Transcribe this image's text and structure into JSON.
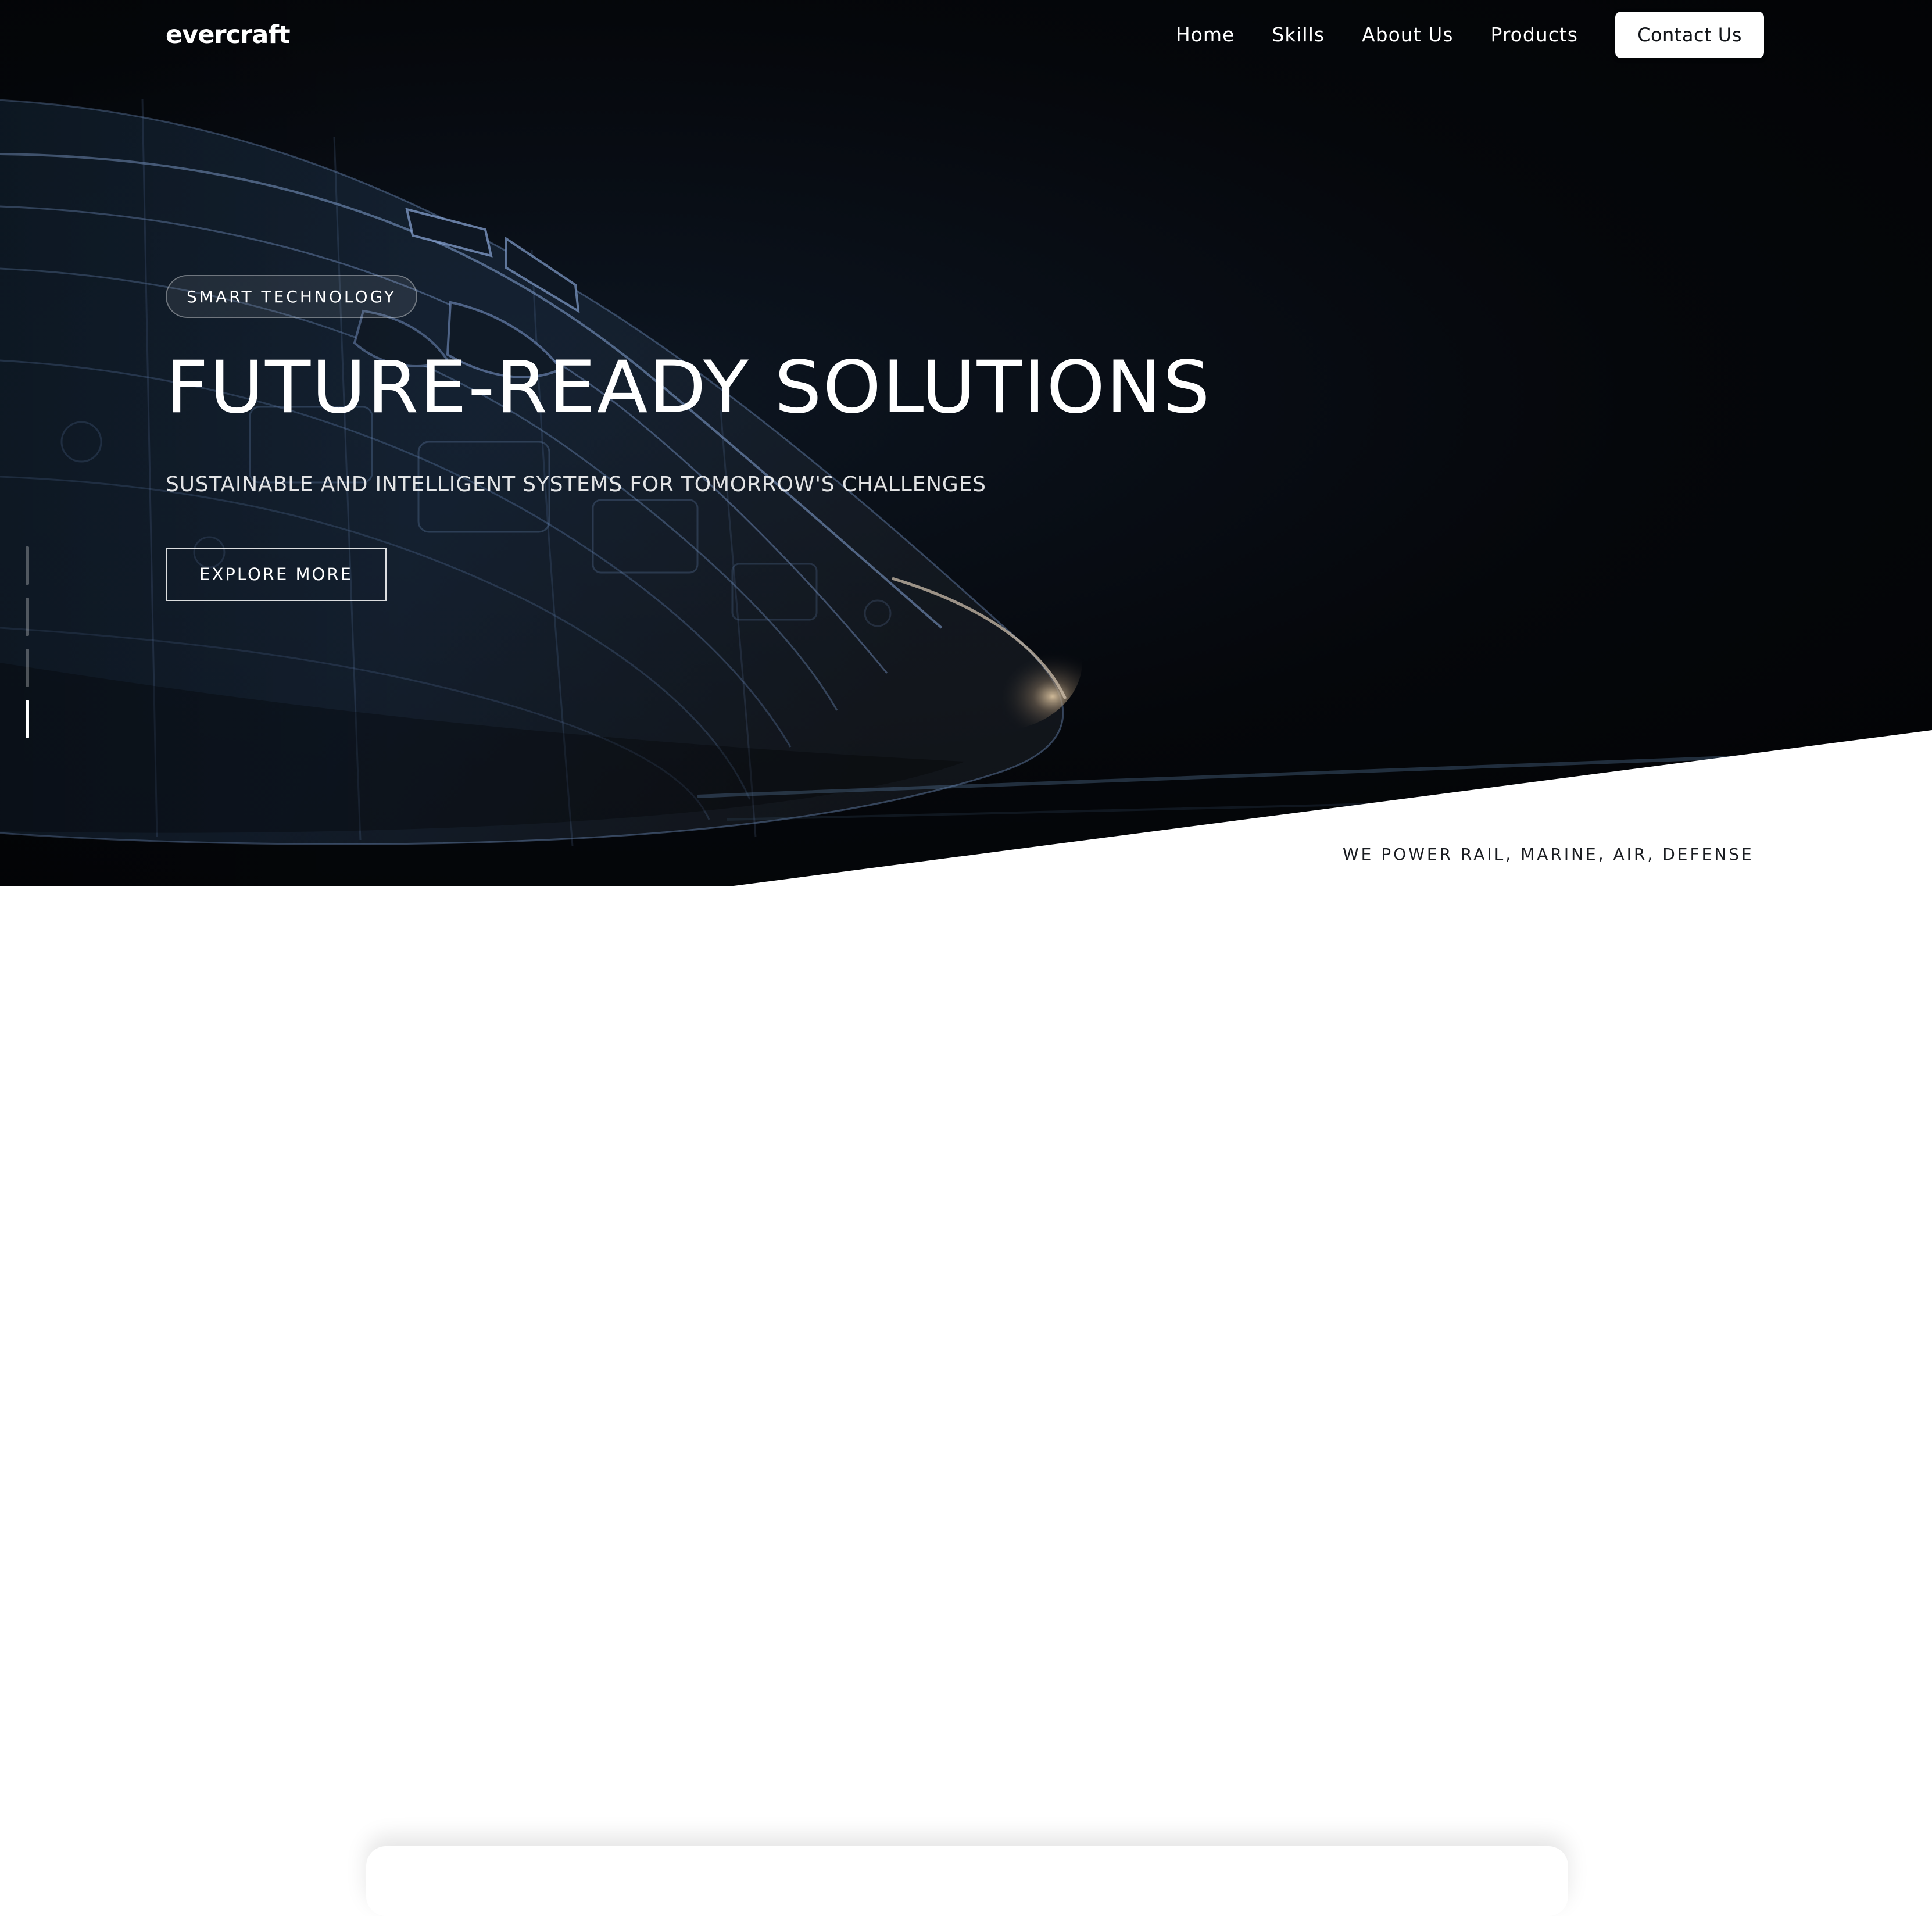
{
  "brand": {
    "name": "evercraft"
  },
  "nav": {
    "items": [
      {
        "label": "Home"
      },
      {
        "label": "Skills"
      },
      {
        "label": "About Us"
      },
      {
        "label": "Products"
      }
    ],
    "contact_label": "Contact Us"
  },
  "hero": {
    "eyebrow": "SMART TECHNOLOGY",
    "headline": "FUTURE-READY SOLUTIONS",
    "subheadline": "SUSTAINABLE AND INTELLIGENT SYSTEMS FOR TOMORROW'S CHALLENGES",
    "button_label": "EXPLORE MORE",
    "slides": {
      "count": 4,
      "active_index": 4
    }
  },
  "tagline": {
    "text": "WE POWER RAIL, MARINE, AIR, DEFENSE"
  },
  "colors": {
    "hero_background": "#05070b",
    "accent": "#ffffff",
    "text_dark": "#1a1d22",
    "wireframe": "#6b8ec4"
  },
  "icons": {
    "hero_image": "aircraft-wireframe-illustration"
  }
}
